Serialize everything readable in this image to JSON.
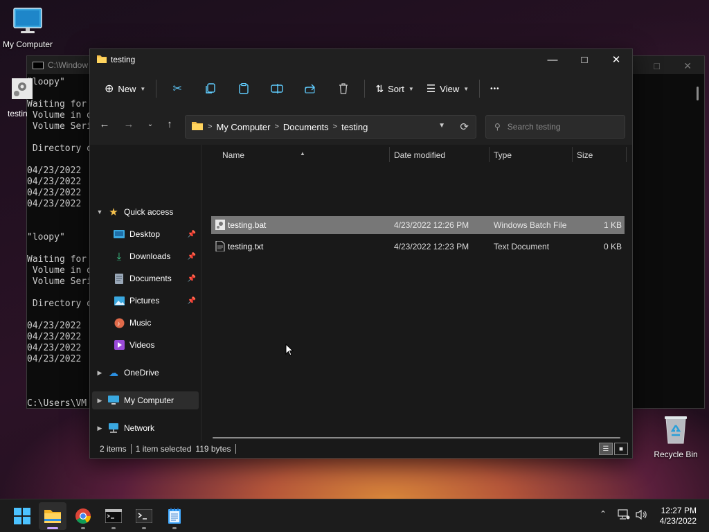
{
  "desktop": {
    "icons": [
      {
        "label": "My Computer",
        "icon": "monitor-icon"
      },
      {
        "label": "Recycle Bin",
        "icon": "recycle-bin-icon"
      }
    ]
  },
  "console": {
    "title": "C:\\Window",
    "file_icon_label": "testin",
    "lines": [
      "\"loopy\"",
      "",
      "Waiting for",
      " Volume in d",
      " Volume Seri",
      "",
      " Directory o",
      "",
      "04/23/2022",
      "04/23/2022",
      "04/23/2022",
      "04/23/2022",
      "",
      "",
      "\"loopy\"",
      "",
      "Waiting for",
      " Volume in d",
      " Volume Seri",
      "",
      " Directory o",
      "",
      "04/23/2022",
      "04/23/2022",
      "04/23/2022",
      "04/23/2022",
      "",
      "",
      "",
      "C:\\Users\\VM"
    ]
  },
  "explorer": {
    "title": "testing",
    "toolbar": {
      "new_label": "New",
      "sort_label": "Sort",
      "view_label": "View",
      "more_label": "•••"
    },
    "address": {
      "crumbs": [
        "My Computer",
        "Documents",
        "testing"
      ]
    },
    "search": {
      "placeholder": "Search testing"
    },
    "sidebar": {
      "quick_access": "Quick access",
      "items": [
        {
          "label": "Desktop",
          "pinned": true
        },
        {
          "label": "Downloads",
          "pinned": true
        },
        {
          "label": "Documents",
          "pinned": true
        },
        {
          "label": "Pictures",
          "pinned": true
        },
        {
          "label": "Music",
          "pinned": false
        },
        {
          "label": "Videos",
          "pinned": false
        }
      ],
      "onedrive": "OneDrive",
      "my_computer": "My Computer",
      "network": "Network"
    },
    "columns": {
      "name": "Name",
      "date": "Date modified",
      "type": "Type",
      "size": "Size"
    },
    "files": [
      {
        "name": "testing.bat",
        "date": "4/23/2022 12:26 PM",
        "type": "Windows Batch File",
        "size": "1 KB",
        "selected": true
      },
      {
        "name": "testing.txt",
        "date": "4/23/2022 12:23 PM",
        "type": "Text Document",
        "size": "0 KB",
        "selected": false
      }
    ],
    "status": {
      "items": "2 items",
      "selected": "1 item selected",
      "bytes": "119 bytes"
    }
  },
  "taskbar": {
    "apps": [
      "start-icon",
      "file-explorer-icon",
      "chrome-icon",
      "command-prompt-icon",
      "terminal-icon",
      "notepad-icon"
    ],
    "clock": {
      "time": "12:27 PM",
      "date": "4/23/2022"
    }
  },
  "colors": {
    "accent": "#60cdff",
    "folder": "#f4c04c",
    "selection": "#777777"
  }
}
